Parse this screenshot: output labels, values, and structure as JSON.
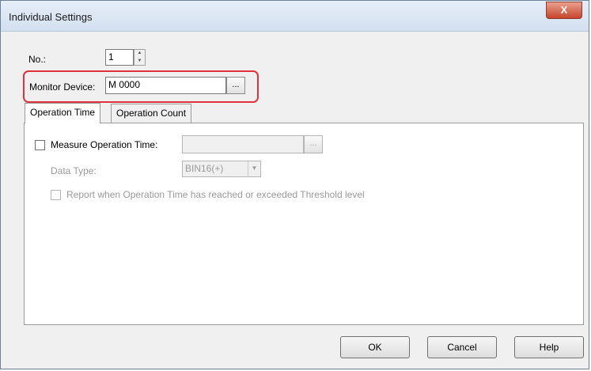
{
  "window": {
    "title": "Individual Settings",
    "close_glyph": "X"
  },
  "no": {
    "label": "No.:",
    "value": "1"
  },
  "monitor_device": {
    "label": "Monitor Device:",
    "value": "M 0000",
    "browse": "..."
  },
  "tabs": [
    {
      "label": "Operation Time",
      "active": true
    },
    {
      "label": "Operation Count",
      "active": false
    }
  ],
  "operation_time": {
    "measure_label": "Measure Operation Time:",
    "measure_checked": false,
    "browse": "...",
    "data_type_label": "Data Type:",
    "data_type_value": "BIN16(+)",
    "report_label": "Report when Operation Time has reached or exceeded Threshold level",
    "report_checked": false
  },
  "buttons": {
    "ok": "OK",
    "cancel": "Cancel",
    "help": "Help"
  },
  "colors": {
    "highlight": "#e0323a",
    "title_bg": "#dce7f5"
  }
}
